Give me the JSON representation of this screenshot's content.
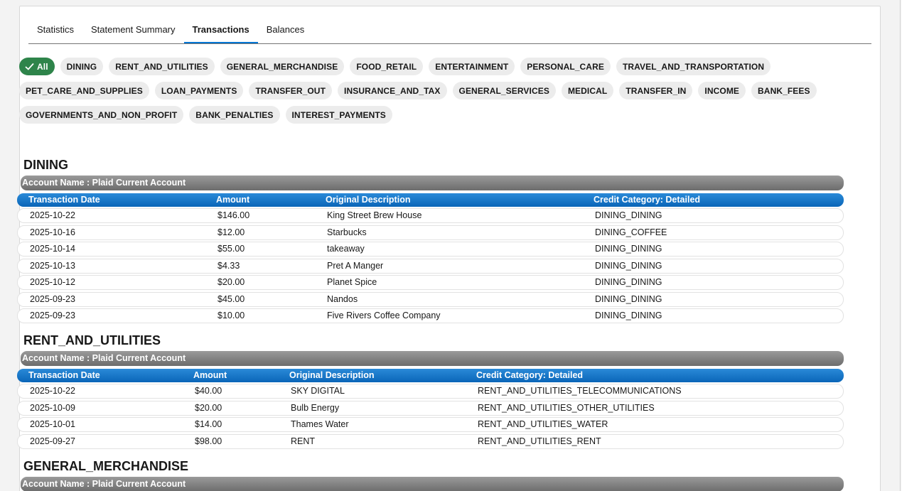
{
  "tabs": [
    "Statistics",
    "Statement Summary",
    "Transactions",
    "Balances"
  ],
  "active_tab": "Transactions",
  "filters": [
    "All",
    "DINING",
    "RENT_AND_UTILITIES",
    "GENERAL_MERCHANDISE",
    "FOOD_RETAIL",
    "ENTERTAINMENT",
    "PERSONAL_CARE",
    "TRAVEL_AND_TRANSPORTATION",
    "PET_CARE_AND_SUPPLIES",
    "LOAN_PAYMENTS",
    "TRANSFER_OUT",
    "INSURANCE_AND_TAX",
    "GENERAL_SERVICES",
    "MEDICAL",
    "TRANSFER_IN",
    "INCOME",
    "BANK_FEES",
    "GOVERNMENTS_AND_NON_PROFIT",
    "BANK_PENALTIES",
    "INTEREST_PAYMENTS"
  ],
  "selected_filter": "All",
  "colors": {
    "accent": "#0176d3",
    "selected_pill": "#2e844a",
    "account_bar": "#7d7d7d",
    "header_bar": "#1b78c8"
  },
  "columns": [
    "Transaction Date",
    "Amount",
    "Original Description",
    "Credit Category: Detailed"
  ],
  "sections": [
    {
      "title": "DINING",
      "account": "Account Name : Plaid Current Account",
      "rows": [
        [
          "2025-10-22",
          "$146.00",
          "King Street Brew House",
          "DINING_DINING"
        ],
        [
          "2025-10-16",
          "$12.00",
          "Starbucks",
          "DINING_COFFEE"
        ],
        [
          "2025-10-14",
          "$55.00",
          "takeaway",
          "DINING_DINING"
        ],
        [
          "2025-10-13",
          "$4.33",
          "Pret A Manger",
          "DINING_DINING"
        ],
        [
          "2025-10-12",
          "$20.00",
          "Planet Spice",
          "DINING_DINING"
        ],
        [
          "2025-09-23",
          "$45.00",
          "Nandos",
          "DINING_DINING"
        ],
        [
          "2025-09-23",
          "$10.00",
          "Five Rivers Coffee Company",
          "DINING_DINING"
        ]
      ]
    },
    {
      "title": "RENT_AND_UTILITIES",
      "account": "Account Name : Plaid Current Account",
      "rows": [
        [
          "2025-10-22",
          "$40.00",
          "SKY DIGITAL",
          "RENT_AND_UTILITIES_TELECOMMUNICATIONS"
        ],
        [
          "2025-10-09",
          "$20.00",
          "Bulb Energy",
          "RENT_AND_UTILITIES_OTHER_UTILITIES"
        ],
        [
          "2025-10-01",
          "$14.00",
          "Thames Water",
          "RENT_AND_UTILITIES_WATER"
        ],
        [
          "2025-09-27",
          "$98.00",
          "RENT",
          "RENT_AND_UTILITIES_RENT"
        ]
      ]
    },
    {
      "title": "GENERAL_MERCHANDISE",
      "account": "Account Name : Plaid Current Account",
      "rows": []
    }
  ]
}
